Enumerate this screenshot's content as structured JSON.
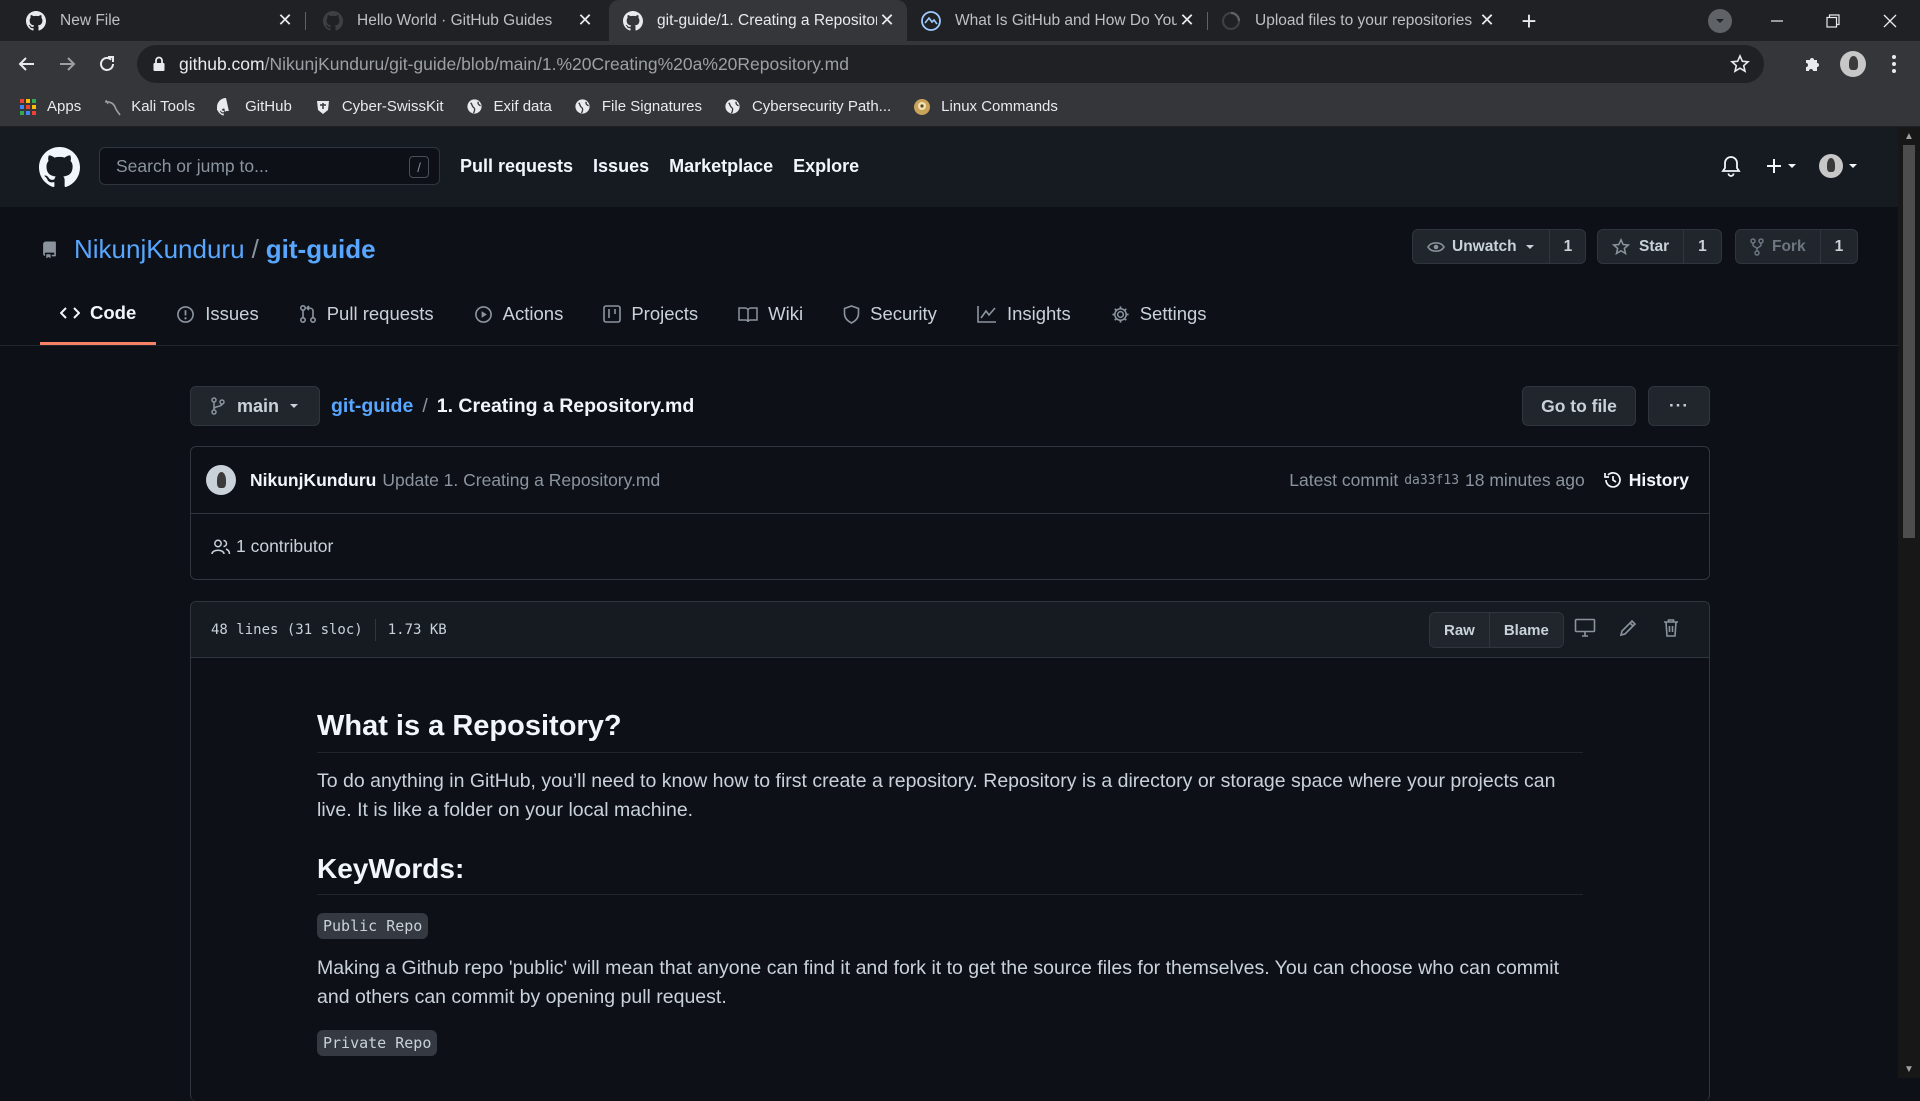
{
  "browser": {
    "tabs": [
      {
        "title": "New File",
        "icon": "github-icon"
      },
      {
        "title": "Hello World · GitHub Guides",
        "icon": "github-icon"
      },
      {
        "title": "git-guide/1. Creating a Repositor",
        "icon": "github-icon",
        "active": true
      },
      {
        "title": "What Is GitHub and How Do You",
        "icon": "globe-icon"
      },
      {
        "title": "Upload files to your repositories",
        "icon": "loading-icon"
      }
    ],
    "url_host": "github.com",
    "url_path": "/NikunjKunduru/git-guide/blob/main/1.%20Creating%20a%20Repository.md",
    "bookmarks": [
      {
        "label": "Apps",
        "icon": "apps-grid-icon"
      },
      {
        "label": "Kali Tools",
        "icon": "kali-icon"
      },
      {
        "label": "GitHub",
        "icon": "github-icon"
      },
      {
        "label": "Cyber-SwissKit",
        "icon": "shield-icon"
      },
      {
        "label": "Exif data",
        "icon": "globe-icon"
      },
      {
        "label": "File Signatures",
        "icon": "globe-icon"
      },
      {
        "label": "Cybersecurity Path...",
        "icon": "globe-icon"
      },
      {
        "label": "Linux Commands",
        "icon": "linux-icon"
      }
    ]
  },
  "github": {
    "search_placeholder": "Search or jump to...",
    "search_shortcut": "/",
    "nav": [
      "Pull requests",
      "Issues",
      "Marketplace",
      "Explore"
    ]
  },
  "repo": {
    "owner": "NikunjKunduru",
    "separator": "/",
    "name": "git-guide",
    "watch_label": "Unwatch",
    "watch_count": "1",
    "star_label": "Star",
    "star_count": "1",
    "fork_label": "Fork",
    "fork_count": "1",
    "tabs": [
      {
        "label": "Code",
        "icon": "code-icon"
      },
      {
        "label": "Issues",
        "icon": "issue-icon"
      },
      {
        "label": "Pull requests",
        "icon": "pull-request-icon"
      },
      {
        "label": "Actions",
        "icon": "play-icon"
      },
      {
        "label": "Projects",
        "icon": "project-icon"
      },
      {
        "label": "Wiki",
        "icon": "book-icon"
      },
      {
        "label": "Security",
        "icon": "shield-icon"
      },
      {
        "label": "Insights",
        "icon": "graph-icon"
      },
      {
        "label": "Settings",
        "icon": "gear-icon"
      }
    ]
  },
  "file": {
    "branch": "main",
    "repo_link": "git-guide",
    "separator": "/",
    "filename": "1. Creating a Repository.md",
    "goto_label": "Go to file",
    "more_label": "···",
    "commit_author": "NikunjKunduru",
    "commit_message": "Update 1. Creating a Repository.md",
    "latest_commit_label": "Latest commit",
    "commit_sha": "da33f13",
    "commit_time": "18 minutes ago",
    "history_label": "History",
    "contributors": "1 contributor",
    "lines_info": "48 lines (31 sloc)",
    "size_info": "1.73 KB",
    "raw_label": "Raw",
    "blame_label": "Blame"
  },
  "markdown": {
    "h1": "What is a Repository?",
    "p1": "To do anything in GitHub, you’ll need to know how to first create a repository. Repository is a directory or storage space where your projects can live. It is like a folder on your local machine.",
    "h2": "KeyWords:",
    "code1": "Public Repo",
    "p2": "Making a Github repo 'public' will mean that anyone can find it and fork it to get the source files for themselves. You can choose who can commit and others can commit by opening pull request.",
    "code2": "Private Repo"
  }
}
